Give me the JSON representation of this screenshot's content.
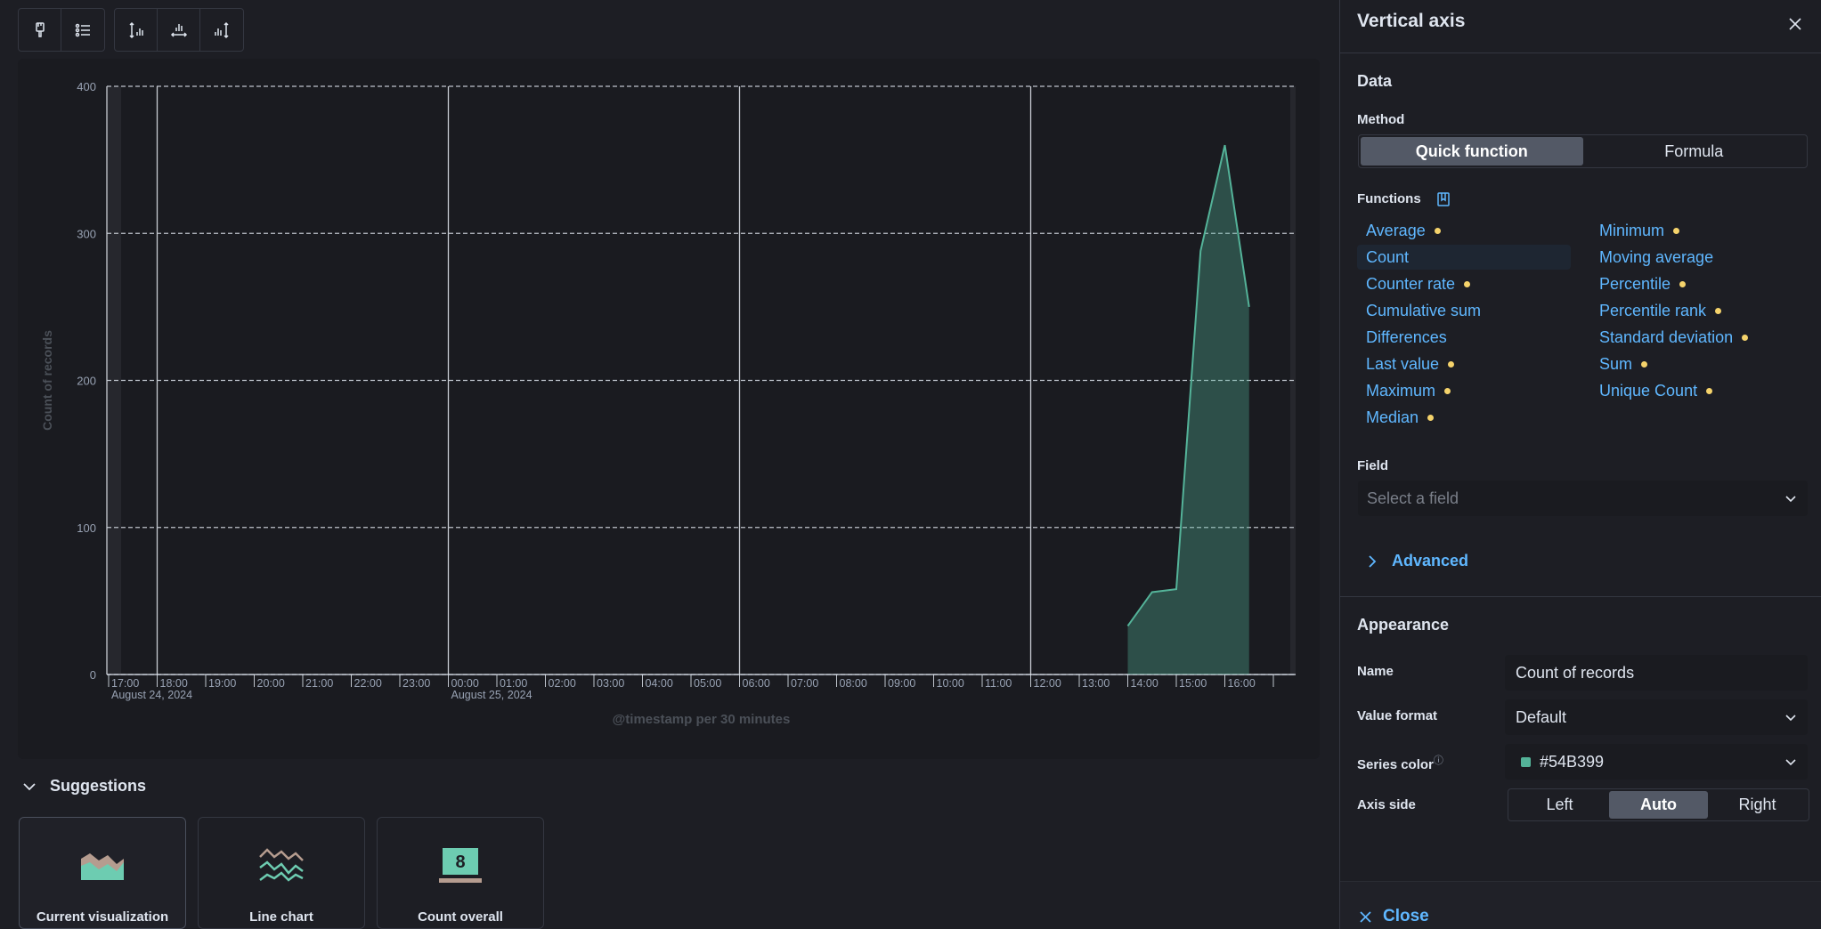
{
  "toolbar": {
    "groups": [
      [
        {
          "icon": "paintbrush-icon"
        },
        {
          "icon": "legend-list-icon"
        }
      ],
      [
        {
          "icon": "left-axis-icon"
        },
        {
          "icon": "bottom-axis-icon"
        },
        {
          "icon": "right-axis-icon"
        }
      ]
    ]
  },
  "chart_data": {
    "type": "area",
    "ylabel": "Count of records",
    "xlabel": "@timestamp per 30 minutes",
    "ylim": [
      0,
      400
    ],
    "yticks": [
      0,
      100,
      200,
      300,
      400
    ],
    "grid": true,
    "x_tick_labels": [
      "17:00",
      "18:00",
      "19:00",
      "20:00",
      "21:00",
      "22:00",
      "23:00",
      "00:00",
      "01:00",
      "02:00",
      "03:00",
      "04:00",
      "05:00",
      "06:00",
      "07:00",
      "08:00",
      "09:00",
      "10:00",
      "11:00",
      "12:00",
      "13:00",
      "14:00",
      "15:00",
      "16:00"
    ],
    "date_labels": [
      {
        "tick": "17:00",
        "date": "August 24, 2024"
      },
      {
        "tick": "00:00",
        "date": "August 25, 2024"
      }
    ],
    "series": [
      {
        "name": "Count of records",
        "color": "#54B399",
        "points": [
          {
            "t": "2024-08-25 14:00",
            "y": 33
          },
          {
            "t": "2024-08-25 14:30",
            "y": 56
          },
          {
            "t": "2024-08-25 15:00",
            "y": 58
          },
          {
            "t": "2024-08-25 15:30",
            "y": 288
          },
          {
            "t": "2024-08-25 16:00",
            "y": 360
          },
          {
            "t": "2024-08-25 16:30",
            "y": 250
          }
        ]
      }
    ]
  },
  "suggestions": {
    "title": "Suggestions",
    "cards": [
      {
        "label": "Current visualization",
        "thumb": "area-chart-thumb",
        "selected": true
      },
      {
        "label": "Line chart",
        "thumb": "line-chart-thumb",
        "selected": false
      },
      {
        "label": "Count overall",
        "thumb": "metric-thumb",
        "metric_value": "8",
        "selected": false
      }
    ]
  },
  "flyout": {
    "title": "Vertical axis",
    "data_section": "Data",
    "method": {
      "label": "Method",
      "options": [
        "Quick function",
        "Formula"
      ],
      "selected": "Quick function"
    },
    "functions": {
      "label": "Functions",
      "left": [
        {
          "name": "Average",
          "dot": true
        },
        {
          "name": "Count",
          "dot": false,
          "selected": true
        },
        {
          "name": "Counter rate",
          "dot": true
        },
        {
          "name": "Cumulative sum",
          "dot": false
        },
        {
          "name": "Differences",
          "dot": false
        },
        {
          "name": "Last value",
          "dot": true
        },
        {
          "name": "Maximum",
          "dot": true
        },
        {
          "name": "Median",
          "dot": true
        }
      ],
      "right": [
        {
          "name": "Minimum",
          "dot": true
        },
        {
          "name": "Moving average",
          "dot": false
        },
        {
          "name": "Percentile",
          "dot": true
        },
        {
          "name": "Percentile rank",
          "dot": true
        },
        {
          "name": "Standard deviation",
          "dot": true
        },
        {
          "name": "Sum",
          "dot": true
        },
        {
          "name": "Unique Count",
          "dot": true
        }
      ]
    },
    "field": {
      "label": "Field",
      "placeholder": "Select a field"
    },
    "advanced": "Advanced",
    "appearance": {
      "title": "Appearance",
      "name_label": "Name",
      "name_value": "Count of records",
      "value_format_label": "Value format",
      "value_format": "Default",
      "series_color_label": "Series color",
      "series_color": "#54B399",
      "axis_side_label": "Axis side",
      "axis_side_options": [
        "Left",
        "Auto",
        "Right"
      ],
      "axis_side_selected": "Auto"
    },
    "close": "Close"
  }
}
